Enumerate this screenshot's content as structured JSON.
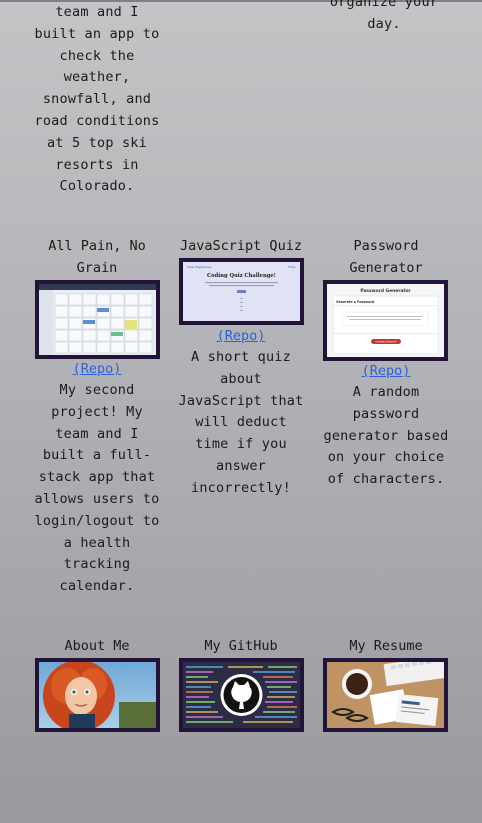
{
  "col_left_top_text": "team and I\nbuilt an app to\ncheck the\nweather,\nsnowfall, and\nroad conditions\nat 5 top ski\nresorts in\nColorado.",
  "col_right_top_text": "organize your\nday.",
  "projects": [
    {
      "title": "All Pain, No\nGrain",
      "repo": "(Repo)",
      "description": "My second\nproject! My\nteam and I\nbuilt a full-\nstack app that\nallows users to\nlogin/logout to\na health\ntracking\ncalendar."
    },
    {
      "title": "JavaScript Quiz",
      "repo": "(Repo)",
      "thumb_heading": "Coding Quiz Challenge!",
      "thumb_nav_left": "View Highscores",
      "thumb_nav_right": "Time",
      "description": "A short quiz\nabout\nJavaScript that\nwill deduct\ntime if you\nanswer\nincorrectly!"
    },
    {
      "title": "Password\nGenerator",
      "repo": "(Repo)",
      "thumb_heading": "Password Generator",
      "thumb_card_title": "Generate a Password",
      "thumb_button": "Generate Password",
      "description": "A random\npassword\ngenerator based\non your choice\nof characters."
    }
  ],
  "links": [
    {
      "title": "About Me",
      "image": "cartoon-girl-red-hair"
    },
    {
      "title": "My GitHub",
      "image": "github-octocat-logo"
    },
    {
      "title": "My Resume",
      "image": "desk-coffee-keyboard"
    }
  ],
  "colors": {
    "frame": "#231339",
    "link": "#2a5fe0",
    "accent_button": "#c0392b"
  }
}
